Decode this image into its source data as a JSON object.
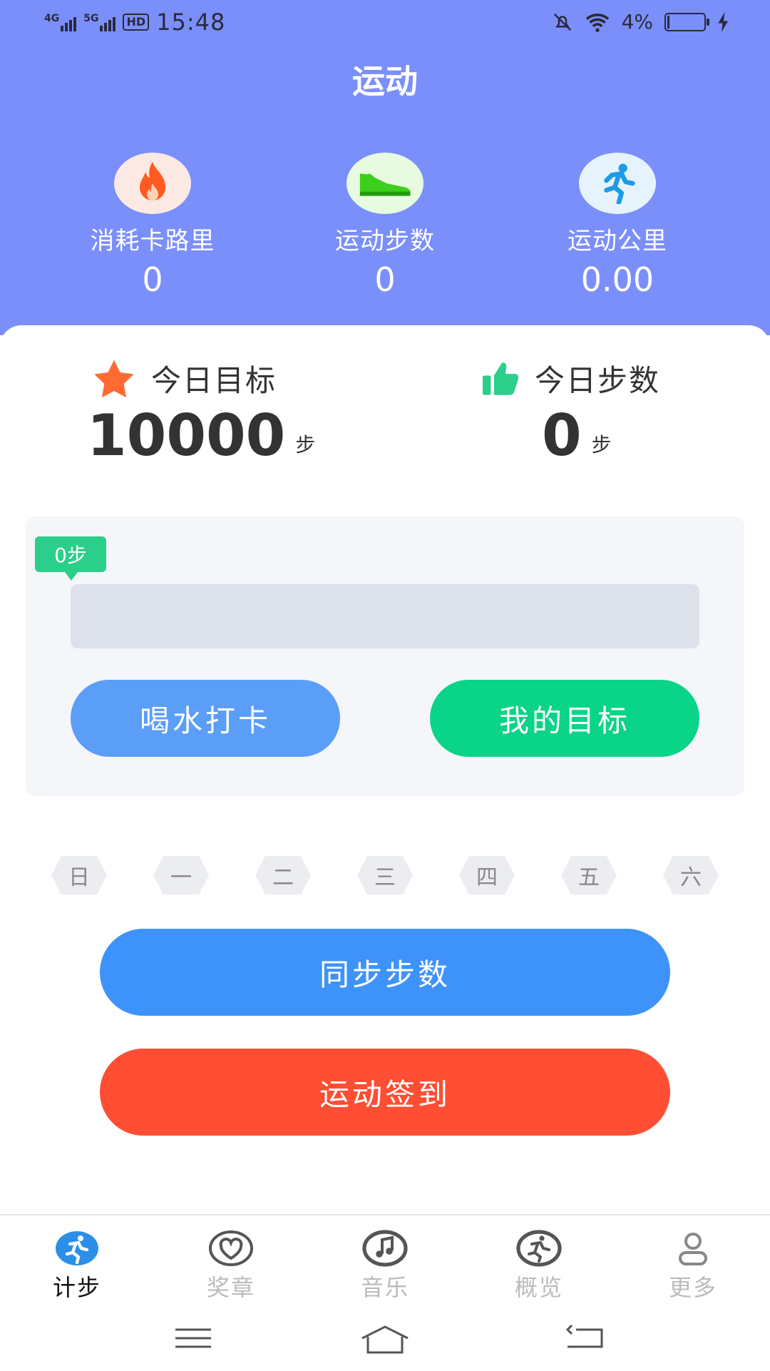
{
  "status_bar": {
    "net1": "4G",
    "net2": "5G",
    "hd": "HD",
    "time": "15:48",
    "battery": "4%"
  },
  "header": {
    "title": "运动"
  },
  "stats": [
    {
      "label": "消耗卡路里",
      "value": "0",
      "icon": "flame-icon"
    },
    {
      "label": "运动步数",
      "value": "0",
      "icon": "shoe-icon"
    },
    {
      "label": "运动公里",
      "value": "0.00",
      "icon": "runner-icon"
    }
  ],
  "goal": {
    "label": "今日目标",
    "value": "10000",
    "unit": "步"
  },
  "today": {
    "label": "今日步数",
    "value": "0",
    "unit": "步"
  },
  "progress": {
    "tip": "0步",
    "fraction": 0
  },
  "actions": {
    "water": "喝水打卡",
    "my_goal": "我的目标"
  },
  "weekdays": [
    "日",
    "一",
    "二",
    "三",
    "四",
    "五",
    "六"
  ],
  "buttons": {
    "sync": "同步步数",
    "checkin": "运动签到"
  },
  "tabs": [
    {
      "label": "计步",
      "icon": "runner-icon",
      "active": true
    },
    {
      "label": "奖章",
      "icon": "heart-icon",
      "active": false
    },
    {
      "label": "音乐",
      "icon": "music-icon",
      "active": false
    },
    {
      "label": "概览",
      "icon": "overview-icon",
      "active": false
    },
    {
      "label": "更多",
      "icon": "person-icon",
      "active": false
    }
  ],
  "colors": {
    "header": "#7b8ffb",
    "water_button": "#5b9ef8",
    "goal_button": "#09d487",
    "sync_button": "#3e93fa",
    "checkin_button": "#ff4e33",
    "tip": "#2bcf8a"
  }
}
